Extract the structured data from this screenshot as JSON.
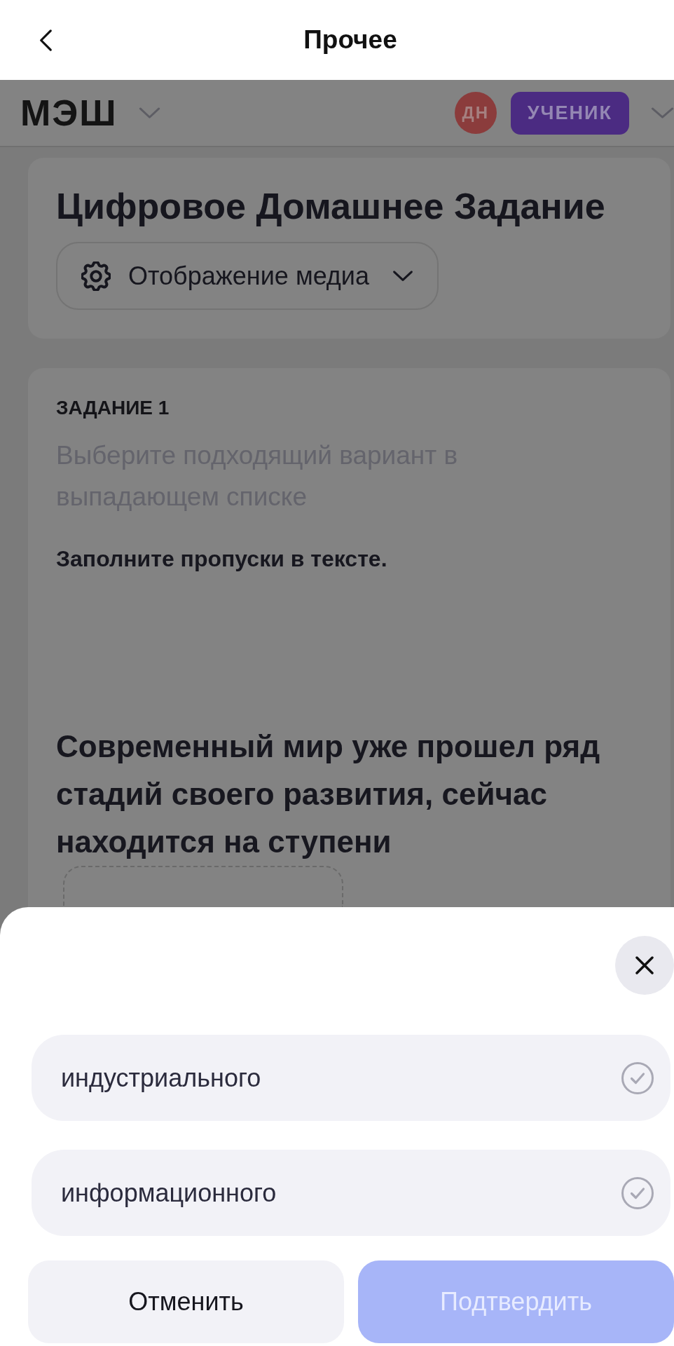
{
  "nav_bar": {
    "title": "Прочее"
  },
  "app_header": {
    "logo": "МЭШ",
    "avatar": {
      "initials": "ДН"
    },
    "role_badge": "УЧЕНИК"
  },
  "title_card": {
    "title": "Цифровое Домашнее Задание",
    "media_dropdown": {
      "label": "Отображение медиа"
    }
  },
  "task": {
    "number": "ЗАДАНИЕ 1",
    "instruction": "Выберите подходящий вариант в выпадающем списке",
    "prompt": "Заполните пропуски в тексте.",
    "sentence": "Современный мир уже прошел ряд стадий своего развития, сейчас находится на ступени"
  },
  "option_sheet": {
    "options": [
      {
        "label": "индустриального",
        "selected": false
      },
      {
        "label": "информационного",
        "selected": false
      }
    ],
    "buttons": [
      {
        "kind": "cancel",
        "label": "Отменить",
        "disabled": false
      },
      {
        "kind": "confirm",
        "label": "Подтвердить",
        "disabled": true
      }
    ]
  }
}
